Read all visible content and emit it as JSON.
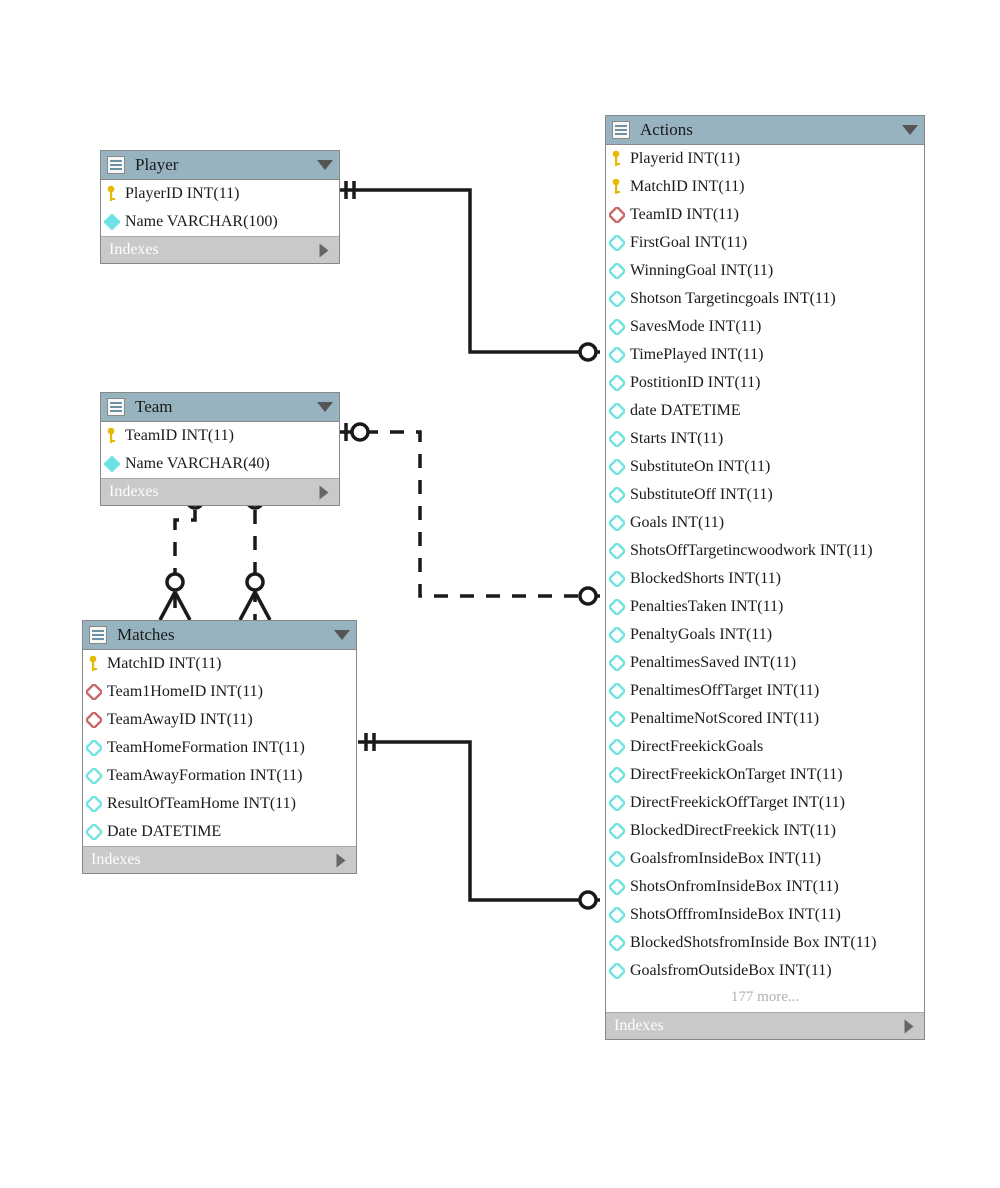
{
  "indexes_label": "Indexes",
  "tables": {
    "player": {
      "title": "Player",
      "columns": [
        {
          "icon": "key",
          "label": "PlayerID INT(11)"
        },
        {
          "icon": "diaF",
          "label": "Name VARCHAR(100)"
        }
      ]
    },
    "team": {
      "title": "Team",
      "columns": [
        {
          "icon": "key",
          "label": "TeamID INT(11)"
        },
        {
          "icon": "diaF",
          "label": "Name VARCHAR(40)"
        }
      ]
    },
    "matches": {
      "title": "Matches",
      "columns": [
        {
          "icon": "key",
          "label": "MatchID INT(11)"
        },
        {
          "icon": "diaR",
          "label": "Team1HomeID INT(11)"
        },
        {
          "icon": "diaR",
          "label": "TeamAwayID INT(11)"
        },
        {
          "icon": "dia",
          "label": "TeamHomeFormation INT(11)"
        },
        {
          "icon": "dia",
          "label": "TeamAwayFormation INT(11)"
        },
        {
          "icon": "dia",
          "label": "ResultOfTeamHome INT(11)"
        },
        {
          "icon": "dia",
          "label": "Date DATETIME"
        }
      ]
    },
    "actions": {
      "title": "Actions",
      "more": "177 more...",
      "columns": [
        {
          "icon": "key",
          "label": "Playerid INT(11)"
        },
        {
          "icon": "key",
          "label": "MatchID INT(11)"
        },
        {
          "icon": "diaR",
          "label": "TeamID INT(11)"
        },
        {
          "icon": "dia",
          "label": "FirstGoal INT(11)"
        },
        {
          "icon": "dia",
          "label": "WinningGoal INT(11)"
        },
        {
          "icon": "dia",
          "label": "Shotson Targetincgoals INT(11)"
        },
        {
          "icon": "dia",
          "label": "SavesMode INT(11)"
        },
        {
          "icon": "dia",
          "label": "TimePlayed INT(11)"
        },
        {
          "icon": "dia",
          "label": "PostitionID INT(11)"
        },
        {
          "icon": "dia",
          "label": "date DATETIME"
        },
        {
          "icon": "dia",
          "label": "Starts INT(11)"
        },
        {
          "icon": "dia",
          "label": "SubstituteOn INT(11)"
        },
        {
          "icon": "dia",
          "label": "SubstituteOff INT(11)"
        },
        {
          "icon": "dia",
          "label": "Goals INT(11)"
        },
        {
          "icon": "dia",
          "label": "ShotsOffTargetincwoodwork INT(11)"
        },
        {
          "icon": "dia",
          "label": "BlockedShorts INT(11)"
        },
        {
          "icon": "dia",
          "label": "PenaltiesTaken INT(11)"
        },
        {
          "icon": "dia",
          "label": "PenaltyGoals INT(11)"
        },
        {
          "icon": "dia",
          "label": "PenaltimesSaved INT(11)"
        },
        {
          "icon": "dia",
          "label": "PenaltimesOffTarget INT(11)"
        },
        {
          "icon": "dia",
          "label": "PenaltimeNotScored INT(11)"
        },
        {
          "icon": "dia",
          "label": "DirectFreekickGoals"
        },
        {
          "icon": "dia",
          "label": "DirectFreekickOnTarget INT(11)"
        },
        {
          "icon": "dia",
          "label": "DirectFreekickOffTarget INT(11)"
        },
        {
          "icon": "dia",
          "label": "BlockedDirectFreekick INT(11)"
        },
        {
          "icon": "dia",
          "label": "GoalsfromInsideBox INT(11)"
        },
        {
          "icon": "dia",
          "label": "ShotsOnfromInsideBox INT(11)"
        },
        {
          "icon": "dia",
          "label": "ShotsOfffromInsideBox INT(11)"
        },
        {
          "icon": "dia",
          "label": "BlockedShotsfromInside Box INT(11)"
        },
        {
          "icon": "dia",
          "label": "GoalsfromOutsideBox INT(11)"
        }
      ]
    }
  }
}
